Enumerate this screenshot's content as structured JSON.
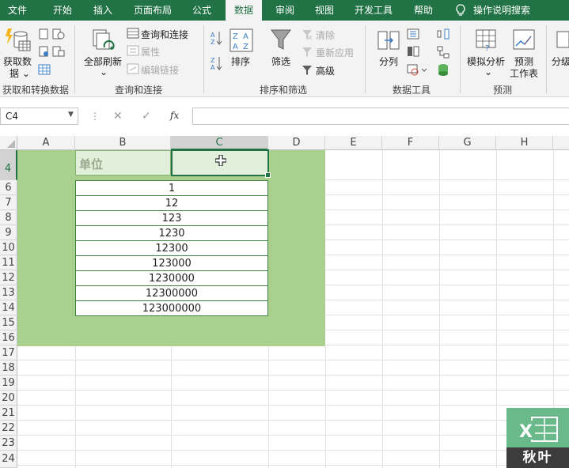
{
  "menu": {
    "tabs": [
      "文件",
      "开始",
      "插入",
      "页面布局",
      "公式",
      "数据",
      "审阅",
      "视图",
      "开发工具",
      "帮助"
    ],
    "active_tab": "数据",
    "tell_me": "操作说明搜索"
  },
  "ribbon": {
    "get_data": {
      "label_line1": "获取数",
      "label_line2": "据 ⌄",
      "group_label": "获取和转换数据"
    },
    "queries": {
      "refresh_all": "全部刷新",
      "queries_connections": "查询和连接",
      "properties": "属性",
      "edit_links": "编辑链接",
      "group_label": "查询和连接"
    },
    "sort_filter": {
      "sort": "排序",
      "filter": "筛选",
      "clear": "清除",
      "reapply": "重新应用",
      "advanced": "高级",
      "group_label": "排序和筛选"
    },
    "data_tools": {
      "text_to_columns": "分列",
      "group_label": "数据工具"
    },
    "forecast": {
      "what_if": "模拟分析",
      "forecast_sheet_line1": "预测",
      "forecast_sheet_line2": "工作表",
      "group_label": "预测"
    },
    "outline": {
      "label": "分级"
    }
  },
  "formula_bar": {
    "name_box": "C4",
    "fx": "fx",
    "cancel": "✕",
    "enter": "✓",
    "more": "⋮",
    "formula": ""
  },
  "sheet": {
    "columns": [
      "A",
      "B",
      "C",
      "D",
      "E",
      "F",
      "G",
      "H"
    ],
    "rows": [
      "4",
      "6",
      "7",
      "8",
      "9",
      "10",
      "11",
      "12",
      "13",
      "14",
      "15",
      "16",
      "17",
      "18",
      "19",
      "20",
      "21",
      "22",
      "23",
      "24"
    ],
    "header_cell": "单位",
    "values": [
      "1",
      "12",
      "123",
      "1230",
      "12300",
      "123000",
      "1230000",
      "12300000",
      "123000000"
    ]
  },
  "watermark": {
    "brand": "秋叶",
    "logo_letter": "X"
  },
  "colors": {
    "excel_green": "#217346",
    "fill_green": "#a9d08e",
    "header_fill": "#e2efda"
  }
}
